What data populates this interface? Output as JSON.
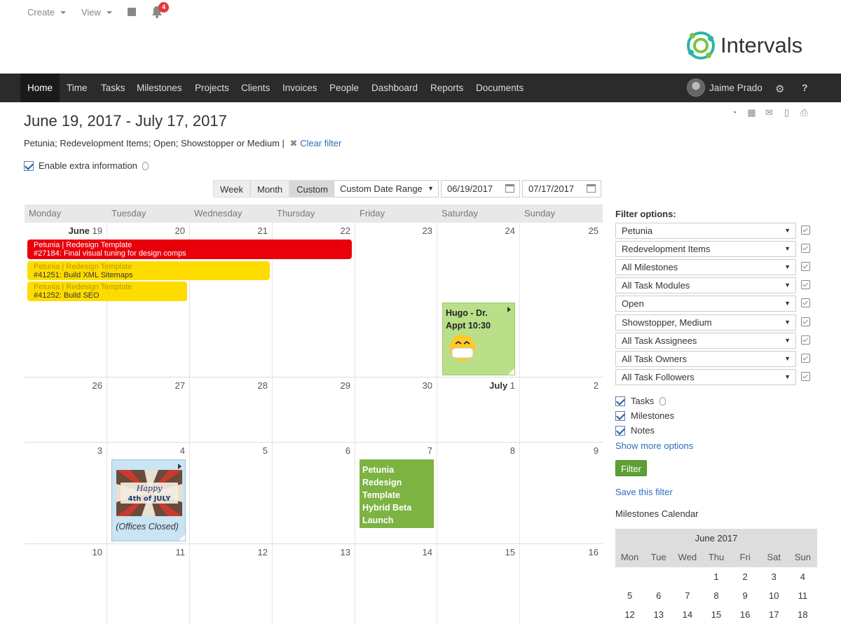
{
  "topbar": {
    "create": "Create",
    "view": "View",
    "notif_count": "4"
  },
  "logo": {
    "text": "Intervals"
  },
  "nav": {
    "items": [
      "Home",
      "Time",
      "Tasks",
      "Milestones",
      "Projects",
      "Clients",
      "Invoices",
      "People",
      "Dashboard",
      "Reports",
      "Documents"
    ],
    "active": "Home",
    "user_name": "Jaime Prado",
    "help": "?"
  },
  "page": {
    "title": "June 19, 2017 - July 17, 2017",
    "filter_summary": "Petunia; Redevelopment Items; Open; Showstopper or Medium |",
    "clear_filter": "Clear filter",
    "extra_info_label": "Enable extra information"
  },
  "views": {
    "week": "Week",
    "month": "Month",
    "custom": "Custom",
    "active": "Custom"
  },
  "date_range": {
    "select": "Custom Date Range",
    "start": "06/19/2017",
    "end": "07/17/2017"
  },
  "calendar": {
    "daynames": [
      "Monday",
      "Tuesday",
      "Wednesday",
      "Thursday",
      "Friday",
      "Saturday",
      "Sunday"
    ],
    "weeks": [
      [
        "June|19",
        "20",
        "21",
        "22",
        "23",
        "24",
        "25"
      ],
      [
        "26",
        "27",
        "28",
        "29",
        "30",
        "July|1",
        "2"
      ],
      [
        "3",
        "4",
        "5",
        "6",
        "7",
        "8",
        "9"
      ],
      [
        "10",
        "11",
        "12",
        "13",
        "14",
        "15",
        "16"
      ]
    ],
    "events": {
      "e1_line1": "Petunia | Redesign Template",
      "e1_line2": "#27184: Final visual tuning for design comps",
      "e2_line1": "Petunia | Redesign Template",
      "e2_line2": "#41251: Build XML Sitemaps",
      "e3_line1": "Petunia | Redesign Template",
      "e3_line2": "#41252: Build SEO"
    },
    "notes": {
      "hugo": "Hugo - Dr. Appt 10:30",
      "july4_caption": "(Offices Closed)",
      "july4_art_line1": "Happy",
      "july4_art_line2": "4th of JULY"
    },
    "milestone": {
      "line1": "Petunia Redesign Template",
      "line2": "Hybrid Beta Launch"
    }
  },
  "sidebar": {
    "title": "Filter options:",
    "filters": [
      "Petunia",
      "Redevelopment Items",
      "All Milestones",
      "All Task Modules",
      "Open",
      "Showstopper, Medium",
      "All Task Assignees",
      "All Task Owners",
      "All Task Followers"
    ],
    "show_tasks": "Tasks",
    "show_milestones": "Milestones",
    "show_notes": "Notes",
    "show_more": "Show more options",
    "filter_button": "Filter",
    "save_filter": "Save this filter",
    "milestones_cal_label": "Milestones Calendar",
    "mini_cal": {
      "month": "June 2017",
      "dows": [
        "Mon",
        "Tue",
        "Wed",
        "Thu",
        "Fri",
        "Sat",
        "Sun"
      ],
      "rows": [
        [
          "",
          "",
          "",
          "1",
          "2",
          "3",
          "4"
        ],
        [
          "5",
          "6",
          "7",
          "8",
          "9",
          "10",
          "11"
        ],
        [
          "12",
          "13",
          "14",
          "15",
          "16",
          "17",
          "18"
        ]
      ]
    }
  },
  "colors": {
    "nav_bg": "#2b2b2b",
    "red_event": "#e8000b",
    "yellow_event": "#ffdc00",
    "milestone": "#7cb342",
    "link": "#2a6ebb",
    "filter_button": "#5d9f35"
  }
}
